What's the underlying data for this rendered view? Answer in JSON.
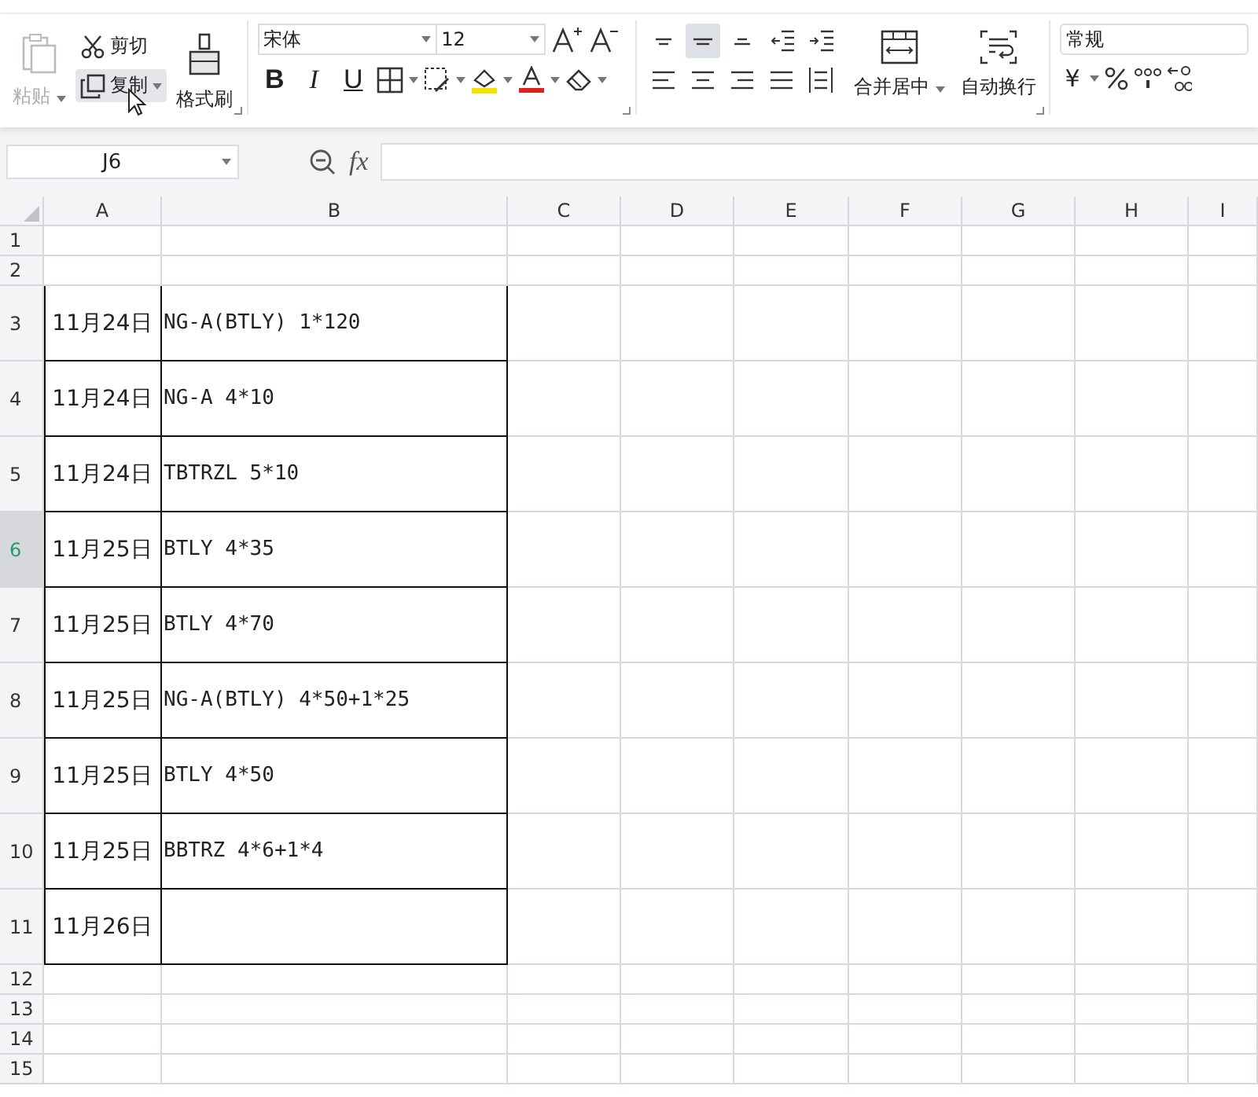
{
  "ribbon": {
    "clipboard": {
      "paste": {
        "label": "粘贴",
        "disabled": true
      },
      "cut": {
        "label": "剪切"
      },
      "copy": {
        "label": "复制",
        "hovered": true
      },
      "format_painter": {
        "label": "格式刷"
      }
    },
    "font": {
      "family": "宋体",
      "size": "12",
      "style_buttons": [
        {
          "kind": "bold",
          "label": "B"
        },
        {
          "kind": "italic",
          "label": "I"
        },
        {
          "kind": "underline",
          "label": "U"
        }
      ]
    },
    "alignment": [
      {
        "kind": "top",
        "selected": false
      },
      {
        "kind": "middle",
        "selected": true
      },
      {
        "kind": "bottom",
        "selected": false
      },
      {
        "kind": "outdent",
        "selected": false
      },
      {
        "kind": "indent",
        "selected": false
      },
      {
        "kind": "left",
        "selected": false
      },
      {
        "kind": "center",
        "selected": false
      },
      {
        "kind": "right",
        "selected": false
      },
      {
        "kind": "justify",
        "selected": false
      },
      {
        "kind": "distribute",
        "selected": false
      }
    ],
    "merge": {
      "label": "合并居中"
    },
    "wrap": {
      "label": "自动换行"
    },
    "number": {
      "format": "常规",
      "currency": "¥"
    }
  },
  "name_box": "J6",
  "formula_label": "fx",
  "columns": [
    "A",
    "B",
    "C",
    "D",
    "E",
    "F",
    "G",
    "H",
    "I"
  ],
  "rows": [
    {
      "header": "1",
      "selected": false,
      "bordered": false,
      "cells": [
        "",
        ""
      ]
    },
    {
      "header": "2",
      "selected": false,
      "bordered": false,
      "cells": [
        "",
        ""
      ]
    },
    {
      "header": "3",
      "selected": false,
      "bordered": true,
      "cells": [
        "11月24日",
        "NG-A(BTLY) 1*120"
      ]
    },
    {
      "header": "4",
      "selected": false,
      "bordered": true,
      "cells": [
        "11月24日",
        "NG-A 4*10"
      ]
    },
    {
      "header": "5",
      "selected": false,
      "bordered": true,
      "cells": [
        "11月24日",
        "TBTRZL 5*10"
      ]
    },
    {
      "header": "6",
      "selected": true,
      "bordered": true,
      "cells": [
        "11月25日",
        "BTLY 4*35"
      ]
    },
    {
      "header": "7",
      "selected": false,
      "bordered": true,
      "cells": [
        "11月25日",
        "BTLY 4*70"
      ]
    },
    {
      "header": "8",
      "selected": false,
      "bordered": true,
      "cells": [
        "11月25日",
        "NG-A(BTLY) 4*50+1*25"
      ]
    },
    {
      "header": "9",
      "selected": false,
      "bordered": true,
      "cells": [
        "11月25日",
        "BTLY 4*50"
      ]
    },
    {
      "header": "10",
      "selected": false,
      "bordered": true,
      "cells": [
        "11月25日",
        "BBTRZ 4*6+1*4"
      ]
    },
    {
      "header": "11",
      "selected": false,
      "bordered": true,
      "cells": [
        "11月26日",
        ""
      ]
    },
    {
      "header": "12",
      "selected": false,
      "bordered": false,
      "cells": [
        "",
        ""
      ]
    },
    {
      "header": "13",
      "selected": false,
      "bordered": false,
      "cells": [
        "",
        ""
      ]
    },
    {
      "header": "14",
      "selected": false,
      "bordered": false,
      "cells": [
        "",
        ""
      ]
    },
    {
      "header": "15",
      "selected": false,
      "bordered": false,
      "cells": [
        "",
        ""
      ]
    }
  ]
}
